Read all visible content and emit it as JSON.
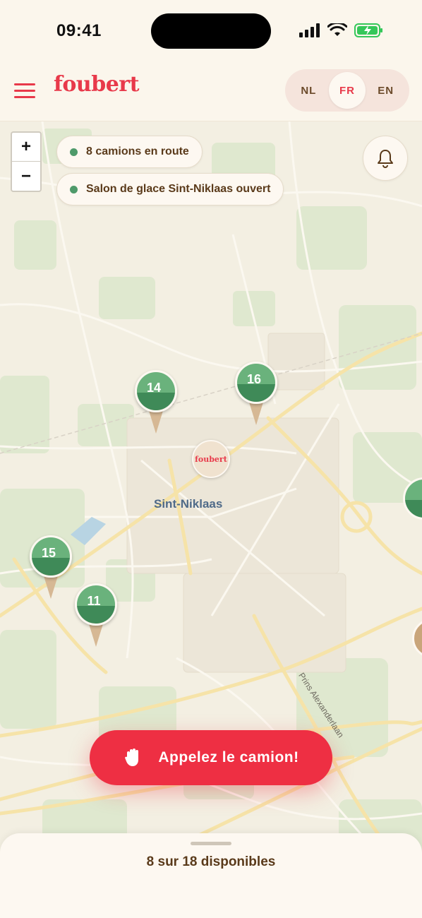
{
  "status_bar": {
    "time": "09:41"
  },
  "header": {
    "logo": "foubert",
    "languages": [
      {
        "code": "NL",
        "active": false
      },
      {
        "code": "FR",
        "active": true
      },
      {
        "code": "EN",
        "active": false
      }
    ]
  },
  "map": {
    "zoom_in": "+",
    "zoom_out": "−",
    "status_pills": [
      "8 camions en route",
      "Salon de glace Sint-Niklaas ouvert"
    ],
    "city_label": "Sint-Niklaas",
    "street_label": "Prins Alexanderlaan",
    "shop_marker_label": "foubert",
    "trucks": [
      "14",
      "16",
      "15",
      "11"
    ],
    "colors": {
      "marker_green_light": "#6ab27c",
      "marker_green_dark": "#3f8a58",
      "accent_red": "#ee2f43"
    }
  },
  "cta": {
    "label": "Appelez le camion!",
    "icon": "hand-icon"
  },
  "bottom_sheet": {
    "availability": "8 sur 18 disponibles"
  }
}
